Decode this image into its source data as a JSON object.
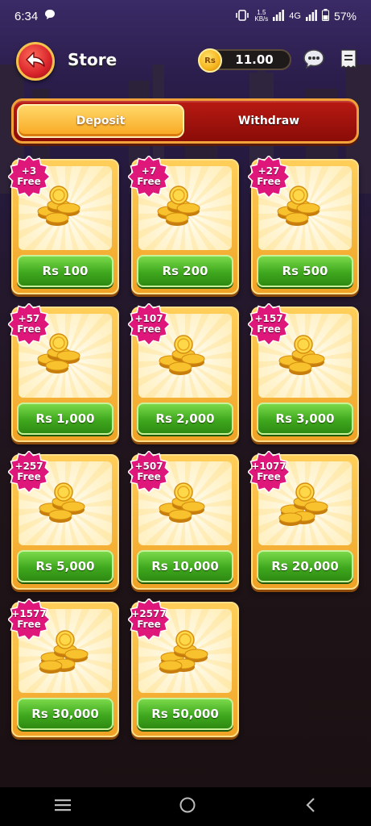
{
  "status_bar": {
    "time": "6:34",
    "net_speed": "1.5",
    "net_unit": "KB/s",
    "network": "4G",
    "battery": "57%"
  },
  "header": {
    "title": "Store",
    "balance_currency": "Rs",
    "balance": "11.00",
    "icons": [
      "back-arrow-icon",
      "support-chat-icon",
      "receipt-icon"
    ]
  },
  "tabs": [
    {
      "label": "Deposit",
      "active": true
    },
    {
      "label": "Withdraw",
      "active": false
    }
  ],
  "packages": [
    {
      "bonus": "+3",
      "free": "Free",
      "price": "Rs 100"
    },
    {
      "bonus": "+7",
      "free": "Free",
      "price": "Rs 200"
    },
    {
      "bonus": "+27",
      "free": "Free",
      "price": "Rs 500"
    },
    {
      "bonus": "+57",
      "free": "Free",
      "price": "Rs 1,000"
    },
    {
      "bonus": "+107",
      "free": "Free",
      "price": "Rs 2,000"
    },
    {
      "bonus": "+157",
      "free": "Free",
      "price": "Rs 3,000"
    },
    {
      "bonus": "+257",
      "free": "Free",
      "price": "Rs 5,000"
    },
    {
      "bonus": "+507",
      "free": "Free",
      "price": "Rs 10,000"
    },
    {
      "bonus": "+1077",
      "free": "Free",
      "price": "Rs 20,000"
    },
    {
      "bonus": "+1577",
      "free": "Free",
      "price": "Rs 30,000"
    },
    {
      "bonus": "+2577",
      "free": "Free",
      "price": "Rs 50,000"
    }
  ],
  "colors": {
    "badge": "#e0177a",
    "price_button": "#3fa81e",
    "card": "#f6b73a",
    "tab_active": "#fbbf3d",
    "tab_bar": "#a8150e"
  },
  "nav_icons": [
    "recents-icon",
    "home-icon",
    "back-icon"
  ]
}
